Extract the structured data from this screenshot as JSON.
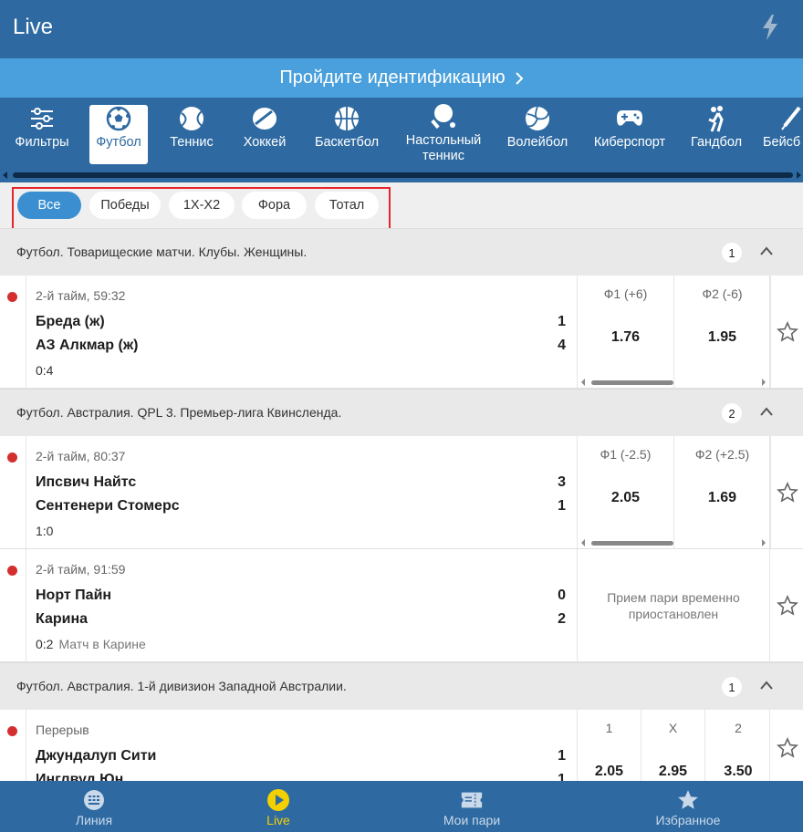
{
  "header": {
    "title": "Live"
  },
  "banner": {
    "text": "Пройдите идентификацию"
  },
  "sports": [
    {
      "label": "Фильтры",
      "icon": "filters-icon",
      "active": false
    },
    {
      "label": "Футбол",
      "icon": "soccer-ball-icon",
      "active": true
    },
    {
      "label": "Теннис",
      "icon": "tennis-ball-icon",
      "active": false
    },
    {
      "label": "Хоккей",
      "icon": "hockey-puck-icon",
      "active": false
    },
    {
      "label": "Баскетбол",
      "icon": "basketball-icon",
      "active": false
    },
    {
      "label": "Настольный теннис",
      "icon": "table-tennis-icon",
      "active": false
    },
    {
      "label": "Волейбол",
      "icon": "volleyball-icon",
      "active": false
    },
    {
      "label": "Киберспорт",
      "icon": "gamepad-icon",
      "active": false
    },
    {
      "label": "Гандбол",
      "icon": "handball-icon",
      "active": false
    },
    {
      "label": "Бейсб",
      "icon": "baseball-bat-icon",
      "active": false
    }
  ],
  "filters": [
    {
      "label": "Все",
      "active": true
    },
    {
      "label": "Победы",
      "active": false
    },
    {
      "label": "1X-X2",
      "active": false
    },
    {
      "label": "Фора",
      "active": false
    },
    {
      "label": "Тотал",
      "active": false
    }
  ],
  "leagues": [
    {
      "name": "Футбол. Товарищеские матчи. Клубы. Женщины.",
      "count": "1",
      "matches": [
        {
          "time": "2-й тайм, 59:32",
          "team1": "Бреда (ж)",
          "score1": "1",
          "team2": "АЗ Алкмар (ж)",
          "score2": "4",
          "total": "0:4",
          "note": "",
          "odds": [
            {
              "label": "Ф1 (+6)",
              "value": "1.76"
            },
            {
              "label": "Ф2 (-6)",
              "value": "1.95"
            }
          ],
          "suspended": ""
        }
      ]
    },
    {
      "name": "Футбол. Австралия. QPL 3. Премьер-лига Квинсленда.",
      "count": "2",
      "matches": [
        {
          "time": "2-й тайм, 80:37",
          "team1": "Ипсвич Найтс",
          "score1": "3",
          "team2": "Сентенери Стомерс",
          "score2": "1",
          "total": "1:0",
          "note": "",
          "odds": [
            {
              "label": "Ф1 (-2.5)",
              "value": "2.05"
            },
            {
              "label": "Ф2 (+2.5)",
              "value": "1.69"
            }
          ],
          "suspended": ""
        },
        {
          "time": "2-й тайм, 91:59",
          "team1": "Норт Пайн",
          "score1": "0",
          "team2": "Карина",
          "score2": "2",
          "total": "0:2",
          "note": "Матч в Карине",
          "odds": [],
          "suspended": "Прием пари временно приостановлен"
        }
      ]
    },
    {
      "name": "Футбол. Австралия. 1-й дивизион Западной Австралии.",
      "count": "1",
      "matches": [
        {
          "time": "Перерыв",
          "team1": "Джундалуп Сити",
          "score1": "1",
          "team2": "Инглвуд Юн",
          "score2": "1",
          "total": "",
          "note": "",
          "odds": [
            {
              "label": "1",
              "value": "2.05"
            },
            {
              "label": "X",
              "value": "2.95"
            },
            {
              "label": "2",
              "value": "3.50"
            }
          ],
          "suspended": ""
        }
      ]
    }
  ],
  "bottom_nav": [
    {
      "label": "Линия",
      "icon": "line-icon",
      "active": false
    },
    {
      "label": "Live",
      "icon": "live-play-icon",
      "active": true
    },
    {
      "label": "Мои пари",
      "icon": "ticket-icon",
      "active": false
    },
    {
      "label": "Избранное",
      "icon": "favorites-star-icon",
      "active": false
    }
  ],
  "colors": {
    "primary": "#2e6aa1",
    "banner": "#4aa0dc",
    "chip_active": "#3b8fd0",
    "live_dot": "#d32f2f",
    "highlight_box": "#e8242b",
    "bottom_active": "#f4d000"
  }
}
